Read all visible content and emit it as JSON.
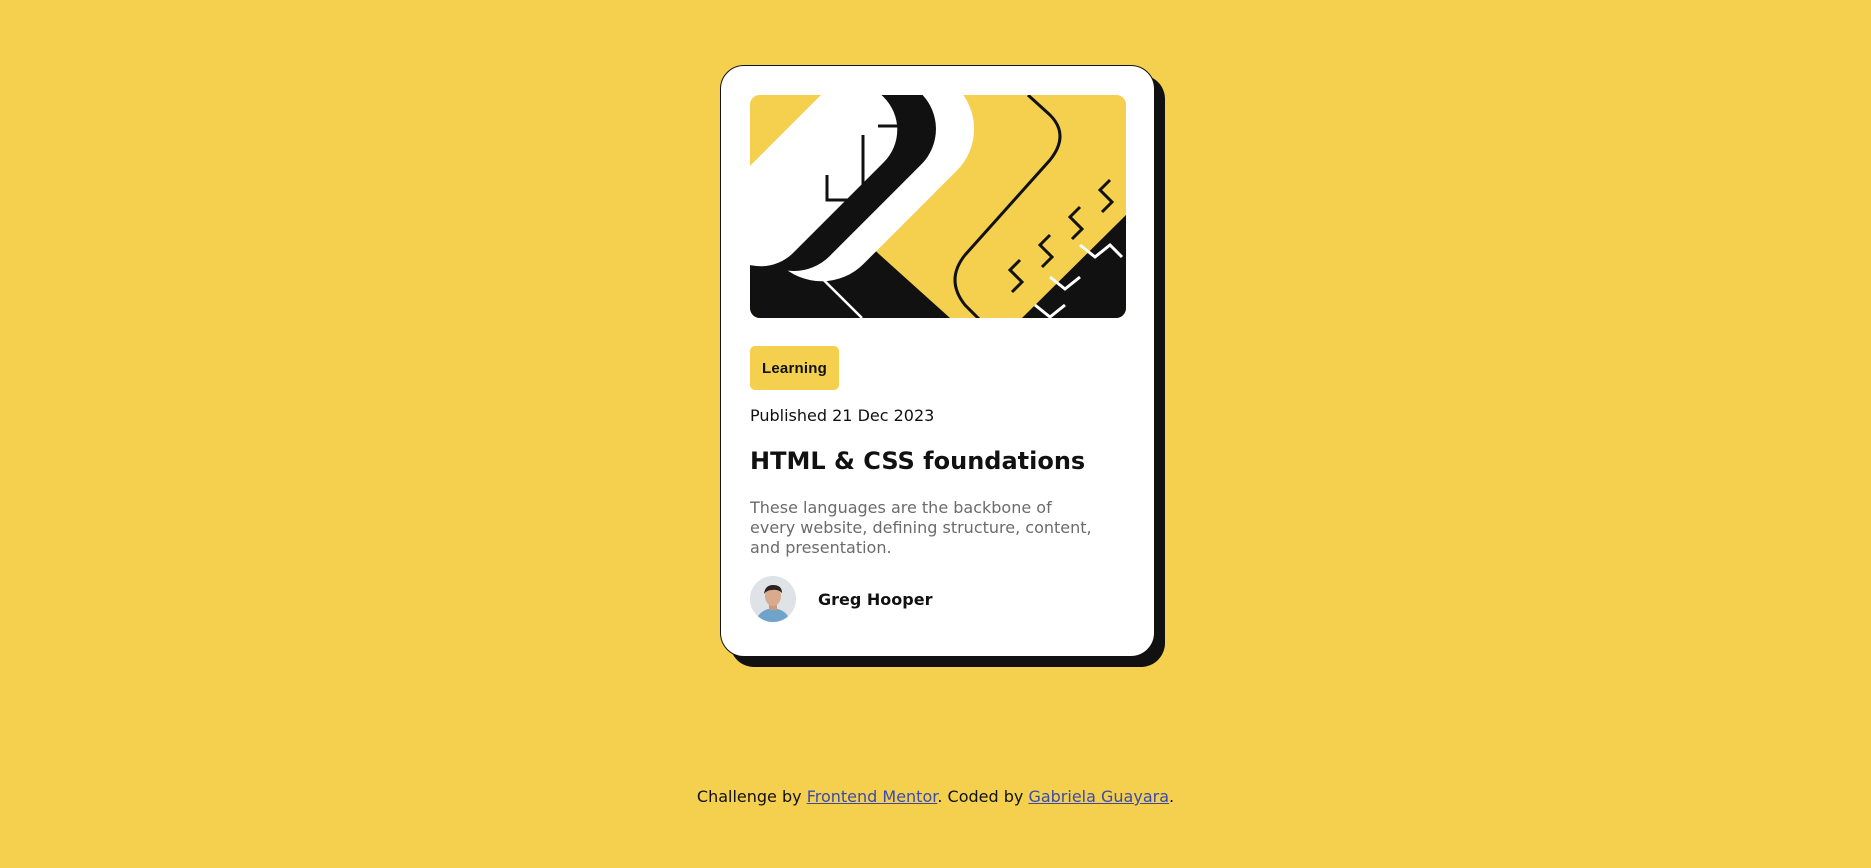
{
  "card": {
    "tag": "Learning",
    "published": "Published 21 Dec 2023",
    "title": "HTML & CSS foundations",
    "description": "These languages are the backbone of every website, defining structure, content, and presentation.",
    "author": {
      "name": "Greg Hooper"
    }
  },
  "footer": {
    "prefix": "Challenge by ",
    "link1": "Frontend Mentor",
    "middle": ". Coded by ",
    "link2": "Gabriela Guayara",
    "suffix": "."
  },
  "colors": {
    "background": "#f4d04e",
    "card": "#ffffff",
    "ink": "#111111",
    "muted": "#6b6b6b",
    "link": "#3b4ba9"
  }
}
